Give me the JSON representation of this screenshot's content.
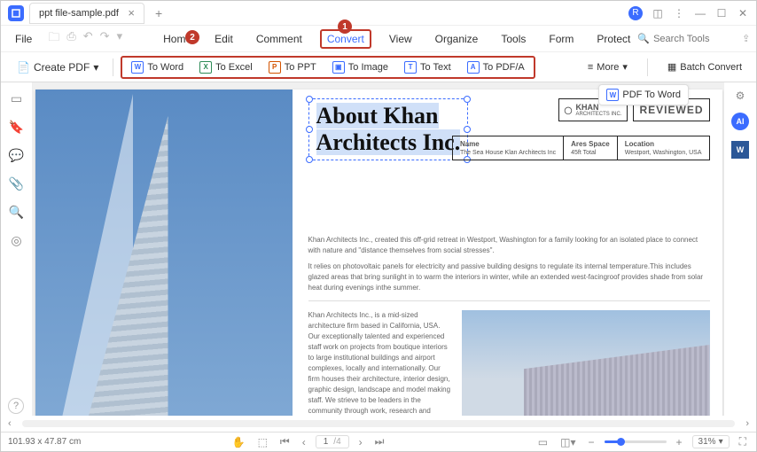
{
  "titlebar": {
    "filename": "ppt file-sample.pdf",
    "user_initial": "R"
  },
  "menubar": {
    "file": "File",
    "tabs": [
      "Home",
      "Edit",
      "Comment",
      "Convert",
      "View",
      "Organize",
      "Tools",
      "Form",
      "Protect"
    ],
    "active_index": 3,
    "search_placeholder": "Search Tools"
  },
  "toolbar": {
    "create": "Create PDF",
    "convert": [
      {
        "label": "To Word",
        "icon": "W",
        "cls": "ic-w"
      },
      {
        "label": "To Excel",
        "icon": "X",
        "cls": "ic-x"
      },
      {
        "label": "To PPT",
        "icon": "P",
        "cls": "ic-p"
      },
      {
        "label": "To Image",
        "icon": "▣",
        "cls": "ic-i"
      },
      {
        "label": "To Text",
        "icon": "T",
        "cls": "ic-t"
      },
      {
        "label": "To PDF/A",
        "icon": "A",
        "cls": "ic-a"
      }
    ],
    "more": "More",
    "batch": "Batch Convert"
  },
  "float_action": "PDF To Word",
  "callouts": {
    "1": "1",
    "2": "2"
  },
  "document": {
    "title_line1": "About Khan",
    "title_line2": "Architects Inc.",
    "logo_name": "KHAN",
    "logo_sub": "ARCHITECTS INC.",
    "reviewed": "REVIEWED",
    "info": [
      {
        "label": "Name",
        "value": "The Sea House Klan Architects Inc"
      },
      {
        "label": "Ares Space",
        "value": "45ft Total"
      },
      {
        "label": "Location",
        "value": "Westport, Washington, USA"
      }
    ],
    "para1": "Khan Architects Inc., created this off-grid retreat in Westport, Washington for a family looking for an isolated place to connect with nature and \"distance themselves from social stresses\".",
    "para2": "It relies on photovoltaic panels for electricity and passive building designs to regulate its internal temperature.This includes glazed areas that bring sunlight in to warm the interiors in winter, while an extended west-facingroof provides shade from solar heat during evenings inthe summer.",
    "para3": "Khan Architects Inc., is a mid-sized architecture firm based in California, USA. Our exceptionally talented and experienced staff work on projects from boutique interiors to large institutional buildings and airport complexes, locally and internationally. Our firm houses their architecture, interior design, graphic design, landscape and model making staff. We strieve to be leaders in the community through work, research and personal choices."
  },
  "statusbar": {
    "dimensions": "101.93 x 47.87 cm",
    "page_current": "1",
    "page_total": "/4",
    "zoom": "31%"
  }
}
